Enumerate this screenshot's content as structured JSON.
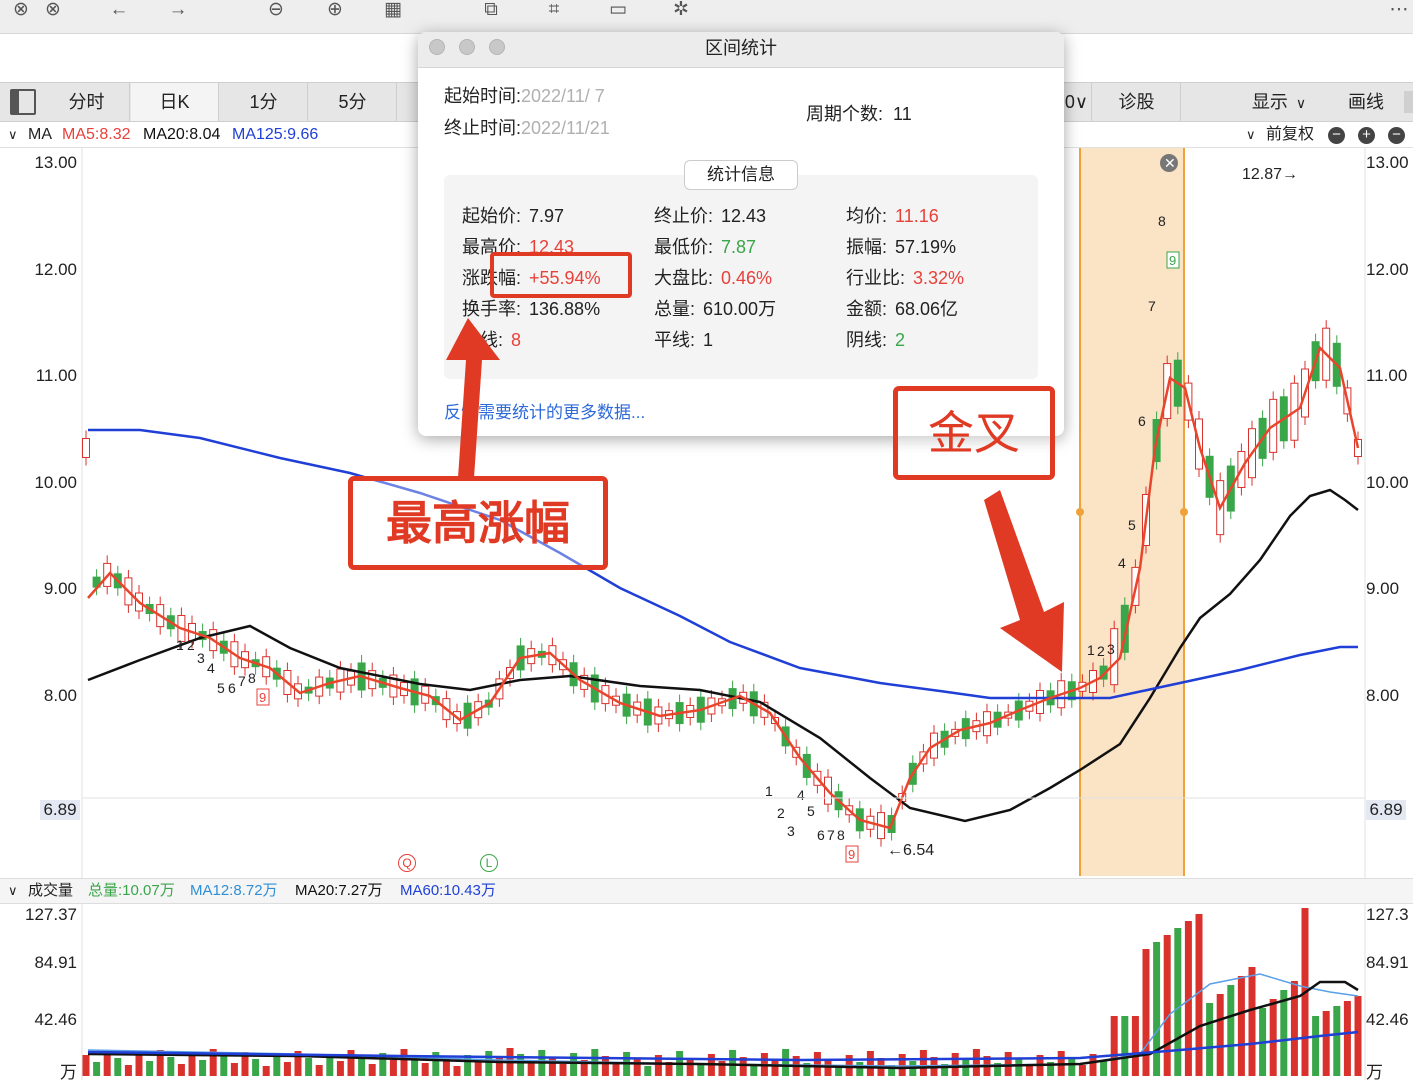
{
  "toolbar": {
    "icons": [
      "close-circle-icon",
      "close-circle-icon",
      "back-arrow-icon",
      "forward-arrow-icon",
      "zoom-out-icon",
      "zoom-in-icon",
      "calendar-icon",
      "translate-icon",
      "frame-icon",
      "crop-icon",
      "magic-wand-icon",
      "more-icon"
    ]
  },
  "tabs": [
    "分时",
    "日K",
    "1分",
    "5分"
  ],
  "right_tabs": {
    "partial": "0∨",
    "diagnose": "诊股",
    "display": "显示",
    "drawline": "画线"
  },
  "ma_bar": {
    "label": "MA",
    "ma5": "MA5:8.32",
    "ma20": "MA20:8.04",
    "ma125": "MA125:9.66",
    "fuquan": "前复权"
  },
  "price_axis": [
    "13.00",
    "12.00",
    "11.00",
    "10.00",
    "9.00",
    "8.00",
    "6.89"
  ],
  "price_markers": {
    "high": "12.87→",
    "low": "←6.54"
  },
  "signal_marks": {
    "q": "Q",
    "l": "L"
  },
  "volume_bar": {
    "label": "成交量",
    "total": "总量:10.07万",
    "ma12": "MA12:8.72万",
    "ma20": "MA20:7.27万",
    "ma60": "MA60:10.43万"
  },
  "volume_axis": {
    "left": [
      "127.37",
      "84.91",
      "42.46",
      "万"
    ],
    "right": [
      "127.3",
      "84.91",
      "42.46",
      "万"
    ]
  },
  "dialog": {
    "title": "区间统计",
    "start_label": "起始时间:",
    "start_value": "2022/11/  7",
    "end_label": "终止时间:",
    "end_value": "2022/11/21",
    "period_label": "周期个数:",
    "period_value": "11",
    "section_title": "统计信息",
    "stats": [
      {
        "label": "起始价:",
        "value": "7.97",
        "color": "#222222"
      },
      {
        "label": "终止价:",
        "value": "12.43",
        "color": "#222222"
      },
      {
        "label": "均价:",
        "value": "11.16",
        "color": "#e8413a"
      },
      {
        "label": "最高价:",
        "value": "12.43",
        "color": "#e8413a"
      },
      {
        "label": "最低价:",
        "value": "7.87",
        "color": "#3aa64a"
      },
      {
        "label": "振幅:",
        "value": "57.19%",
        "color": "#222222"
      },
      {
        "label": "涨跌幅:",
        "value": "+55.94%",
        "color": "#e8413a"
      },
      {
        "label": "大盘比:",
        "value": "0.46%",
        "color": "#e8413a"
      },
      {
        "label": "行业比:",
        "value": "3.32%",
        "color": "#e8413a"
      },
      {
        "label": "换手率:",
        "value": "136.88%",
        "color": "#222222"
      },
      {
        "label": "总量:",
        "value": "610.00万",
        "color": "#222222"
      },
      {
        "label": "金额:",
        "value": "68.06亿",
        "color": "#222222"
      },
      {
        "label": "阳线:",
        "value": "8",
        "color": "#e8413a"
      },
      {
        "label": "平线:",
        "value": "1",
        "color": "#222222"
      },
      {
        "label": "阴线:",
        "value": "2",
        "color": "#3aa64a"
      }
    ],
    "feedback_link": "反馈需要统计的更多数据..."
  },
  "annotations": {
    "highest_gain": "最高涨幅",
    "golden_cross": "金叉"
  },
  "colors": {
    "up": "#d9312c",
    "down": "#3aa64a",
    "ma5": "#e8452c",
    "ma20": "#111111",
    "ma125": "#1f3fd6",
    "highlight": "#fbe3c6",
    "annotation": "#e03a24"
  }
}
